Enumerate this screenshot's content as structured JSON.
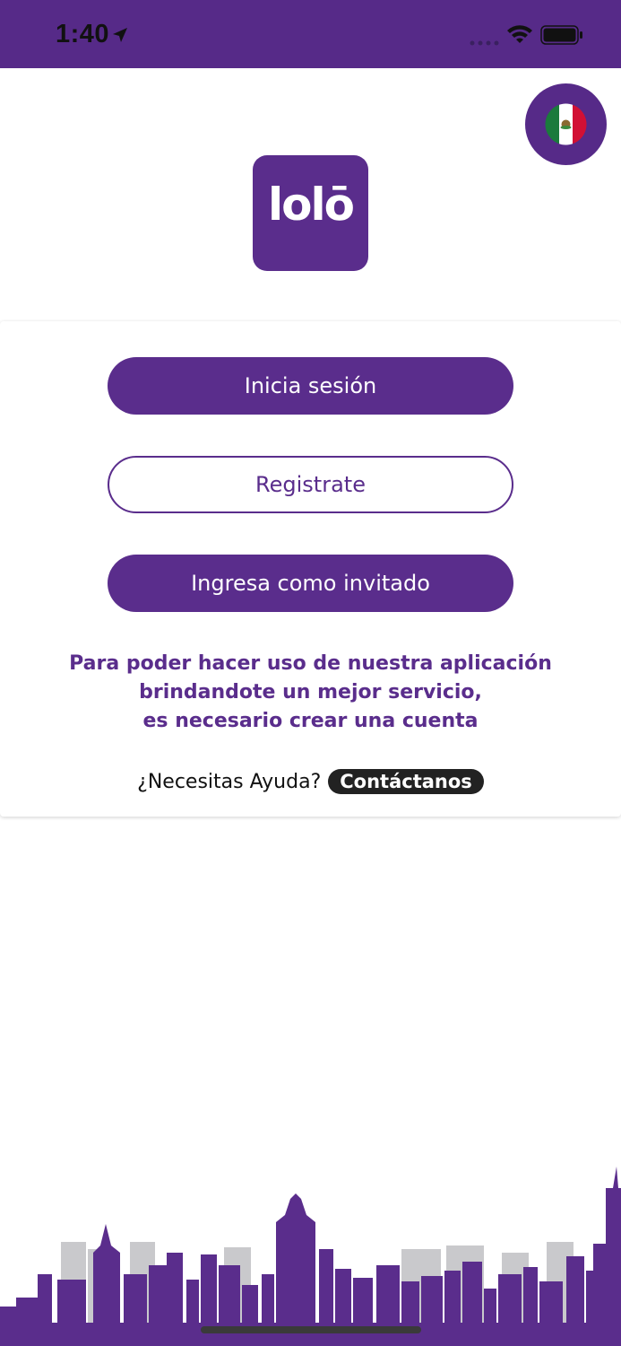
{
  "status_bar": {
    "time": "1:40"
  },
  "language": {
    "flag": "mexico-flag-icon"
  },
  "logo": {
    "text": "lolō"
  },
  "actions": {
    "login_label": "Inicia sesión",
    "register_label": "Registrate",
    "guest_label": "Ingresa como invitado"
  },
  "info": {
    "line1": "Para poder hacer uso de nuestra aplicación",
    "line2": "brindandote un mejor servicio,",
    "line3": "es necesario crear una cuenta"
  },
  "help": {
    "question": "¿Necesitas Ayuda?",
    "contact_label": "Contáctanos"
  },
  "colors": {
    "brand": "#5a2d8c",
    "status_bar": "#562a88",
    "contact_bg": "#222222"
  }
}
